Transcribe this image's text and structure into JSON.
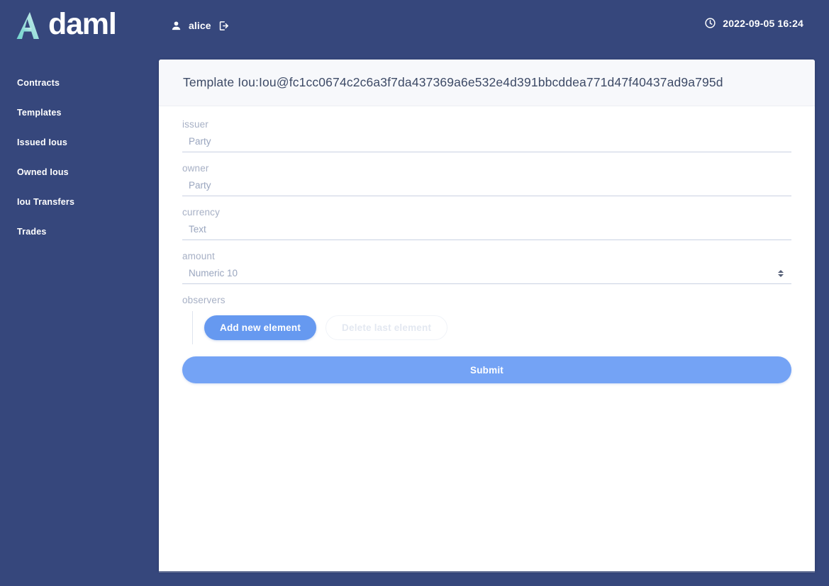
{
  "brand": {
    "logo_text": "daml",
    "logo_mark_icon": "daml-a-logo-icon",
    "logo_color_light": "#7fd9d2",
    "logo_color_mid": "#b8e6e4",
    "logo_color_text": "#ffffff"
  },
  "topbar": {
    "user_icon": "person-icon",
    "user_name": "alice",
    "logout_icon": "sign-out-icon",
    "clock_icon": "clock-icon",
    "datetime": "2022-09-05 16:24"
  },
  "sidebar": {
    "items": [
      {
        "label": "Contracts",
        "name": "contracts"
      },
      {
        "label": "Templates",
        "name": "templates"
      },
      {
        "label": "Issued Ious",
        "name": "issued-ious"
      },
      {
        "label": "Owned Ious",
        "name": "owned-ious"
      },
      {
        "label": "Iou Transfers",
        "name": "iou-transfers"
      },
      {
        "label": "Trades",
        "name": "trades"
      }
    ]
  },
  "card": {
    "title": "Template Iou:Iou@fc1cc0674c2c6a3f7da437369a6e532e4d391bbcddea771d47f40437ad9a795d"
  },
  "form": {
    "fields": [
      {
        "label": "issuer",
        "placeholder": "Party",
        "value": "",
        "type": "text"
      },
      {
        "label": "owner",
        "placeholder": "Party",
        "value": "",
        "type": "text"
      },
      {
        "label": "currency",
        "placeholder": "Text",
        "value": "",
        "type": "text"
      },
      {
        "label": "amount",
        "placeholder": "Numeric 10",
        "value": "",
        "type": "number"
      }
    ],
    "observers": {
      "label": "observers",
      "add_label": "Add new element",
      "delete_label": "Delete last element"
    },
    "submit_label": "Submit"
  },
  "colors": {
    "app_background": "#36477c",
    "card_background": "#ffffff",
    "card_header_background": "#f7f8fb",
    "primary_button": "#6699f0",
    "submit_button": "#74a3f5",
    "label_text": "#a7b0c5",
    "title_text": "#3d4a66"
  }
}
